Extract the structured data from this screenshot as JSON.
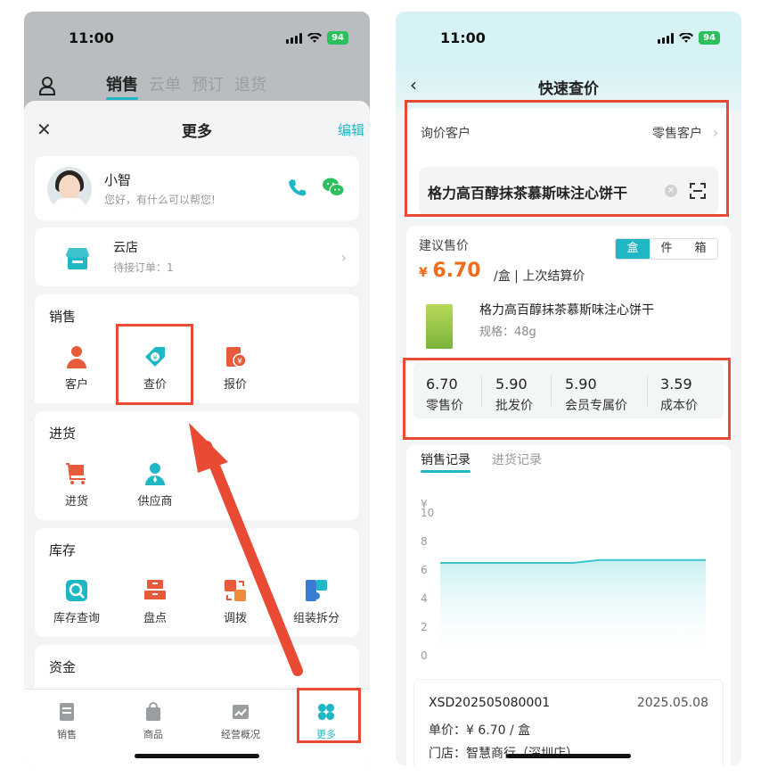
{
  "left": {
    "status": {
      "time": "11:00",
      "battery": "94"
    },
    "topnav": {
      "tabs": [
        "销售",
        "云单",
        "预订",
        "退货"
      ]
    },
    "sheet": {
      "title": "更多",
      "edit_label": "编辑"
    },
    "assistant": {
      "name": "小智",
      "greeting": "您好，有什么可以帮您!"
    },
    "cloud_store": {
      "title": "云店",
      "subtitle": "待接订单：1"
    },
    "sections": {
      "sales": {
        "title": "销售",
        "items": [
          "客户",
          "查价",
          "报价"
        ]
      },
      "purchase": {
        "title": "进货",
        "items": [
          "进货",
          "供应商"
        ]
      },
      "inventory": {
        "title": "库存",
        "items": [
          "库存查询",
          "盘点",
          "调拨",
          "组装拆分"
        ]
      },
      "funds": {
        "title": "资金"
      }
    },
    "bottom_nav": [
      "销售",
      "商品",
      "经营概况",
      "更多"
    ]
  },
  "right": {
    "status": {
      "time": "11:00",
      "battery": "94"
    },
    "header": {
      "title": "快速查价"
    },
    "customer": {
      "label": "询价客户",
      "value": "零售客户"
    },
    "search": {
      "value": "格力高百醇抹茶慕斯味注心饼干"
    },
    "suggest": {
      "label": "建议售价",
      "units": [
        "盒",
        "件",
        "箱"
      ],
      "currency": "¥",
      "price": "6.70",
      "per_unit": "/盒 | 上次结算价"
    },
    "product": {
      "name": "格力高百醇抹茶慕斯味注心饼干",
      "spec": "规格：48g"
    },
    "prices": [
      {
        "value": "6.70",
        "label": "零售价"
      },
      {
        "value": "5.90",
        "label": "批发价"
      },
      {
        "value": "5.90",
        "label": "会员专属价"
      },
      {
        "value": "3.59",
        "label": "成本价"
      }
    ],
    "subtabs": [
      "销售记录",
      "进货记录"
    ],
    "record": {
      "id": "XSD202505080001",
      "date": "2025.05.08",
      "unit_price": "单价：¥ 6.70 / 盒",
      "store": "门店：智慧商行（深圳店）"
    }
  },
  "chart_data": {
    "type": "area",
    "ylabel": "¥",
    "yticks": [
      0,
      2,
      4,
      6,
      8,
      10
    ],
    "ylim": [
      0,
      10
    ],
    "values": [
      6.5,
      6.5,
      6.5,
      6.5,
      6.5,
      6.5,
      6.7,
      6.7,
      6.7,
      6.7,
      6.7
    ],
    "colors": {
      "line": "#3cc5cf",
      "fill": "#c9f0f3"
    }
  },
  "colors": {
    "accent": "#20b7c4",
    "highlight": "#e84a34",
    "price": "#f06a1a"
  }
}
